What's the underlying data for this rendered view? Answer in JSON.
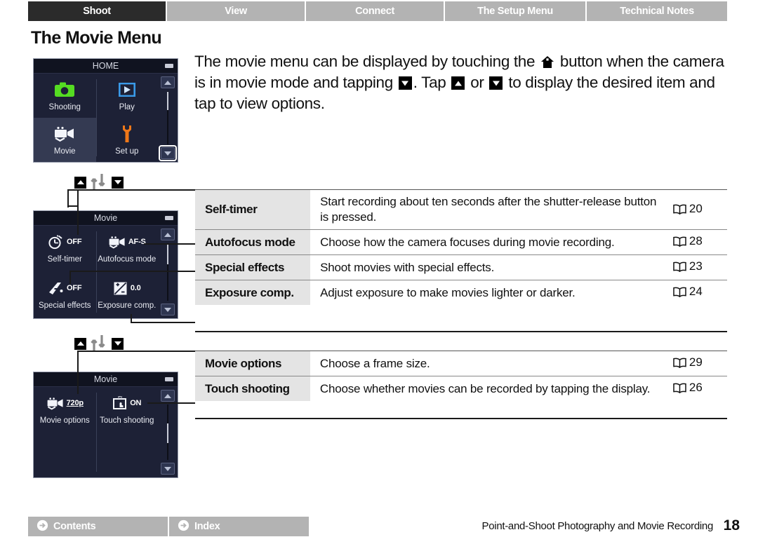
{
  "tabs": [
    {
      "label": "Shoot",
      "active": true
    },
    {
      "label": "View",
      "active": false
    },
    {
      "label": "Connect",
      "active": false
    },
    {
      "label": "The Setup Menu",
      "active": false
    },
    {
      "label": "Technical Notes",
      "active": false
    }
  ],
  "page_title": "The Movie Menu",
  "intro": {
    "part1": "The movie menu can be displayed by touching the ",
    "part2": " button when the camera is in movie mode and tapping ",
    "part3": ". Tap ",
    "part4": " or ",
    "part5": " to display the desired item and tap to view options."
  },
  "screens": {
    "home": {
      "title": "HOME",
      "items": [
        {
          "label": "Shooting",
          "icon": "camera-icon",
          "highlight": false
        },
        {
          "label": "Play",
          "icon": "play-icon",
          "highlight": false
        },
        {
          "label": "Movie",
          "icon": "movie-camera-icon",
          "highlight": true
        },
        {
          "label": "Set up",
          "icon": "wrench-icon",
          "highlight": false
        }
      ]
    },
    "movie1": {
      "title": "Movie",
      "items": [
        {
          "label": "Self-timer",
          "value": "OFF",
          "icon": "timer-icon"
        },
        {
          "label": "Autofocus mode",
          "value": "AF-S",
          "icon": "movie-camera-icon"
        },
        {
          "label": "Special effects",
          "value": "OFF",
          "icon": "effects-icon"
        },
        {
          "label": "Exposure comp.",
          "value": "0.0",
          "icon": "exposure-icon"
        }
      ]
    },
    "movie2": {
      "title": "Movie",
      "items": [
        {
          "label": "Movie options",
          "value": "720p",
          "icon": "movie-camera-icon"
        },
        {
          "label": "Touch shooting",
          "value": "ON",
          "icon": "touch-icon"
        }
      ]
    }
  },
  "table_rows": [
    {
      "name": "Self-timer",
      "desc": "Start recording about ten seconds after the shutter-release button is pressed.",
      "page": "20"
    },
    {
      "name": "Autofocus mode",
      "desc": "Choose how the camera focuses during movie recording.",
      "page": "28"
    },
    {
      "name": "Special effects",
      "desc": "Shoot movies with special effects.",
      "page": "23"
    },
    {
      "name": "Exposure comp.",
      "desc": "Adjust exposure to make movies lighter or darker.",
      "page": "24"
    }
  ],
  "table_rows2": [
    {
      "name": "Movie options",
      "desc": "Choose a frame size.",
      "page": "29"
    },
    {
      "name": "Touch shooting",
      "desc": "Choose whether movies can be recorded by tapping the display.",
      "page": "26"
    }
  ],
  "footer": {
    "contents": "Contents",
    "index": "Index",
    "running_head": "Point-and-Shoot Photography and Movie Recording",
    "page_number": "18"
  },
  "colors": {
    "tab_active": "#2b2b2b",
    "tab_inactive": "#b3b3b3",
    "screen_bg": "#1d2136",
    "screen_header": "#101320",
    "icon_green": "#55dd22",
    "icon_blue": "#3a9ae8",
    "icon_orange": "#f07818",
    "row_name_bg": "#e4e4e4"
  }
}
